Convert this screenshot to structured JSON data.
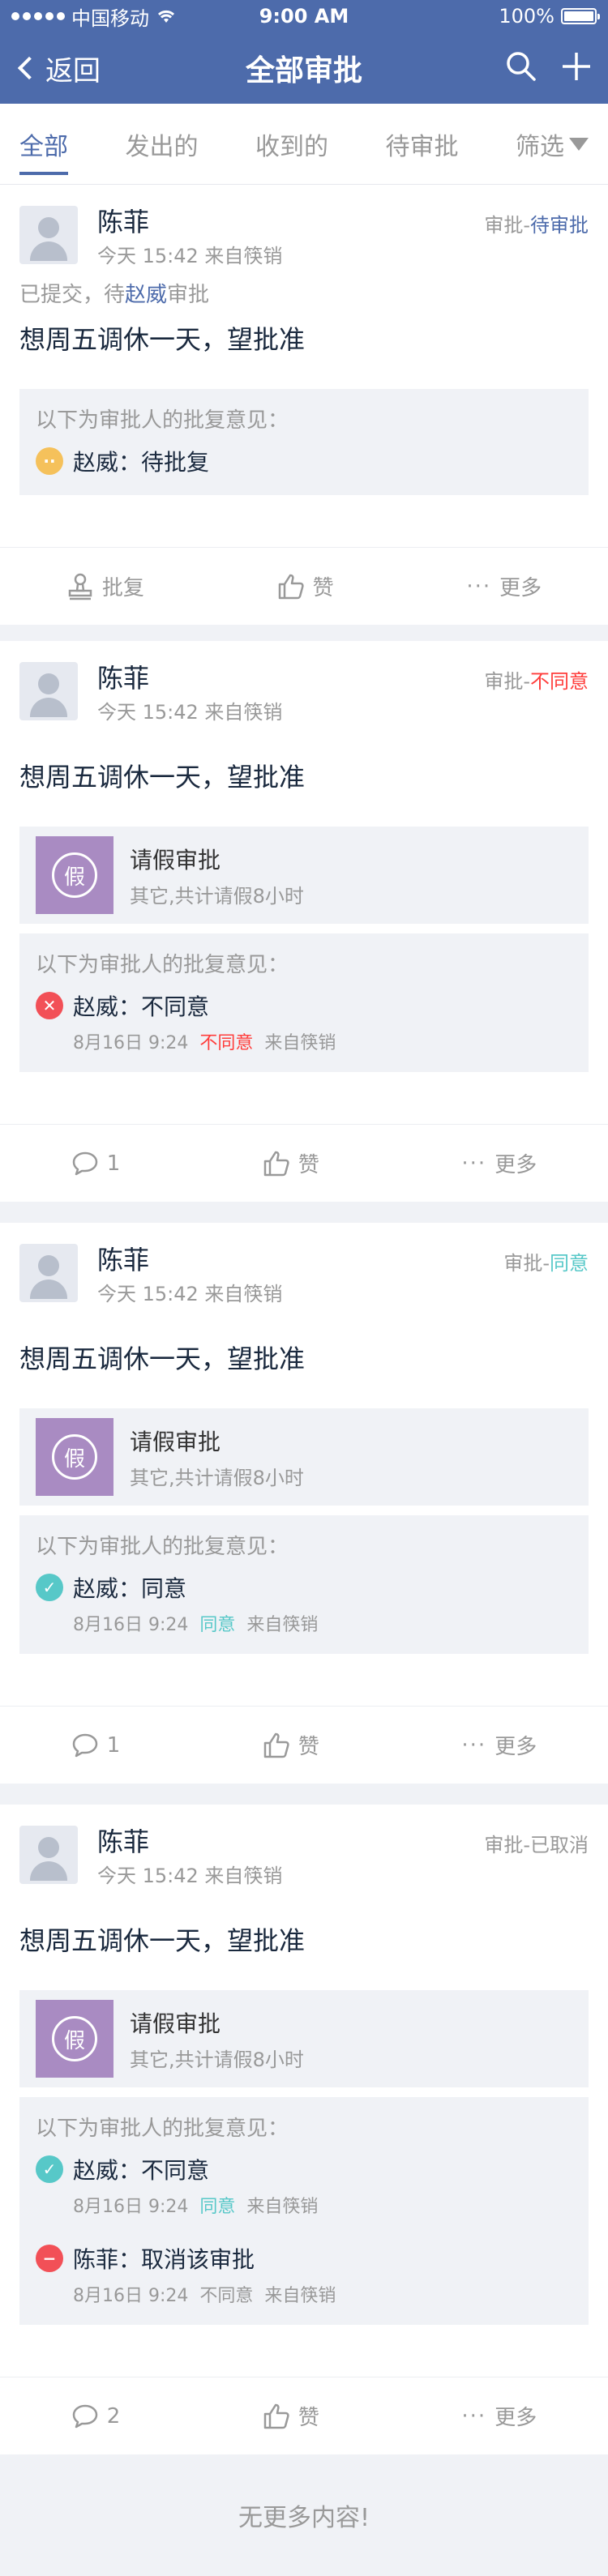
{
  "statusbar": {
    "carrier": "中国移动",
    "time": "9:00 AM",
    "battery": "100%"
  },
  "nav": {
    "back_label": "返回",
    "title": "全部审批"
  },
  "tabs": [
    {
      "label": "全部",
      "active": true
    },
    {
      "label": "发出的"
    },
    {
      "label": "收到的"
    },
    {
      "label": "待审批"
    },
    {
      "label": "筛选"
    }
  ],
  "cards": [
    {
      "name": "陈菲",
      "meta": "今天 15:42 来自筷销",
      "status_prefix": "审批-",
      "status": "待审批",
      "submitted_prefix": "已提交，待",
      "submitted_who": "赵威",
      "submitted_suffix": "审批",
      "text": "想周五调休一天，望批准",
      "opinion_title": "以下为审批人的批复意见：",
      "opinions": [
        {
          "line": "赵威：待批复"
        }
      ],
      "actions": [
        "批复",
        "赞",
        "更多"
      ]
    },
    {
      "name": "陈菲",
      "meta": "今天 15:42 来自筷销",
      "status_prefix": "审批-",
      "status": "不同意",
      "text": "想周五调休一天，望批准",
      "leave_icon": "假",
      "leave_title": "请假审批",
      "leave_sub": "其它,共计请假8小时",
      "opinion_title": "以下为审批人的批复意见：",
      "opinions": [
        {
          "line": "赵威：不同意",
          "date": "8月16日  9:24",
          "result": "不同意",
          "source": "来自筷销"
        }
      ],
      "actions": [
        "1",
        "赞",
        "更多"
      ]
    },
    {
      "name": "陈菲",
      "meta": "今天 15:42 来自筷销",
      "status_prefix": "审批-",
      "status": "同意",
      "text": "想周五调休一天，望批准",
      "leave_icon": "假",
      "leave_title": "请假审批",
      "leave_sub": "其它,共计请假8小时",
      "opinion_title": "以下为审批人的批复意见：",
      "opinions": [
        {
          "line": "赵威：同意",
          "date": "8月16日  9:24",
          "result": "同意",
          "source": "来自筷销"
        }
      ],
      "actions": [
        "1",
        "赞",
        "更多"
      ]
    },
    {
      "name": "陈菲",
      "meta": "今天 15:42 来自筷销",
      "status_prefix": "审批-",
      "status": "已取消",
      "text": "想周五调休一天，望批准",
      "leave_icon": "假",
      "leave_title": "请假审批",
      "leave_sub": "其它,共计请假8小时",
      "opinion_title": "以下为审批人的批复意见：",
      "opinions": [
        {
          "line": "赵威：不同意",
          "date": "8月16日  9:24",
          "result": "同意",
          "source": "来自筷销"
        },
        {
          "line": "陈菲：取消该审批",
          "date": "8月16日  9:24",
          "result": "不同意",
          "source": "来自筷销"
        }
      ],
      "actions": [
        "2",
        "赞",
        "更多"
      ]
    }
  ],
  "footer": "无更多内容!"
}
